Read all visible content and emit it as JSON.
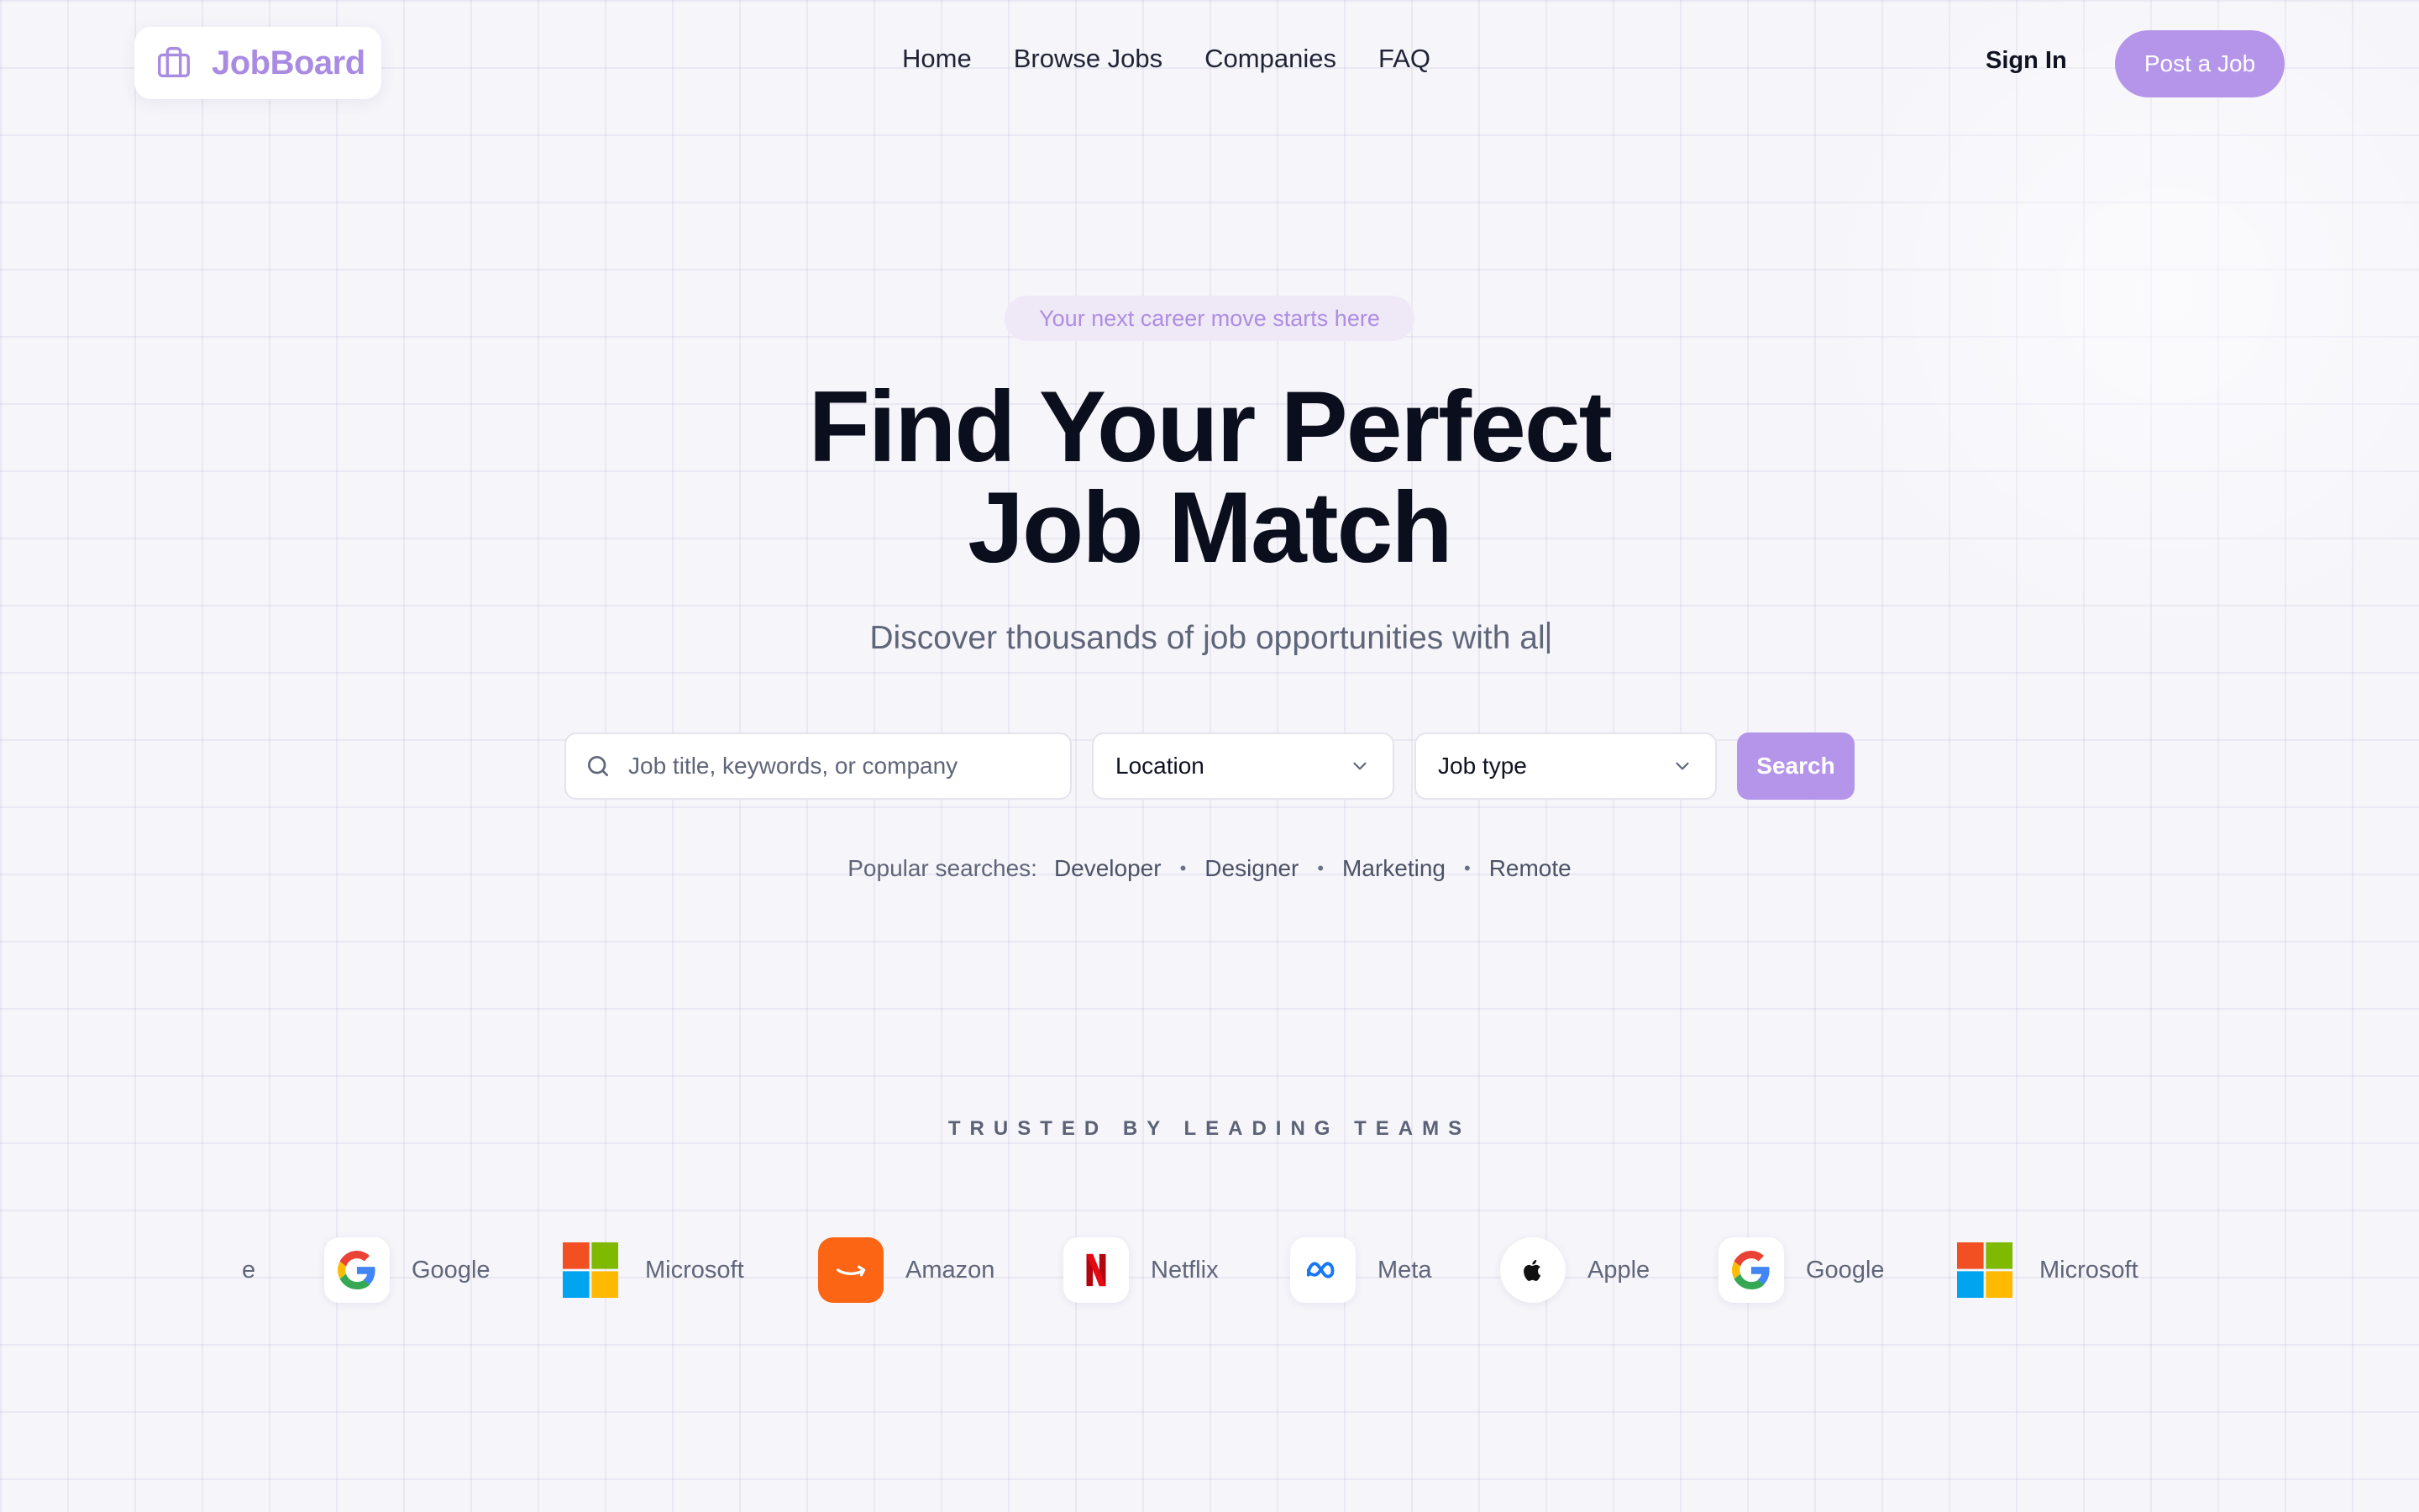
{
  "brand": {
    "name": "JobBoard",
    "accent": "#b595ea"
  },
  "nav": {
    "links": [
      "Home",
      "Browse Jobs",
      "Companies",
      "FAQ"
    ],
    "sign_in": "Sign In",
    "post_job": "Post a Job"
  },
  "hero": {
    "tagline": "Your next career move starts here",
    "headline_line1": "Find Your Perfect",
    "headline_line2": "Job Match",
    "subtitle": "Discover thousands of job opportunities with al"
  },
  "search": {
    "placeholder": "Job title, keywords, or company",
    "location": "Location",
    "job_type": "Job type",
    "button": "Search"
  },
  "popular": {
    "label": "Popular searches:",
    "tags": [
      "Developer",
      "Designer",
      "Marketing",
      "Remote"
    ]
  },
  "trusted": {
    "heading": "TRUSTED BY LEADING TEAMS",
    "partial": "e",
    "logos": [
      {
        "name": "Google",
        "icon": "google-icon"
      },
      {
        "name": "Microsoft",
        "icon": "microsoft-icon"
      },
      {
        "name": "Amazon",
        "icon": "amazon-icon"
      },
      {
        "name": "Netflix",
        "icon": "netflix-icon"
      },
      {
        "name": "Meta",
        "icon": "meta-icon"
      },
      {
        "name": "Apple",
        "icon": "apple-icon"
      },
      {
        "name": "Google",
        "icon": "google-icon"
      },
      {
        "name": "Microsoft",
        "icon": "microsoft-icon"
      }
    ]
  }
}
